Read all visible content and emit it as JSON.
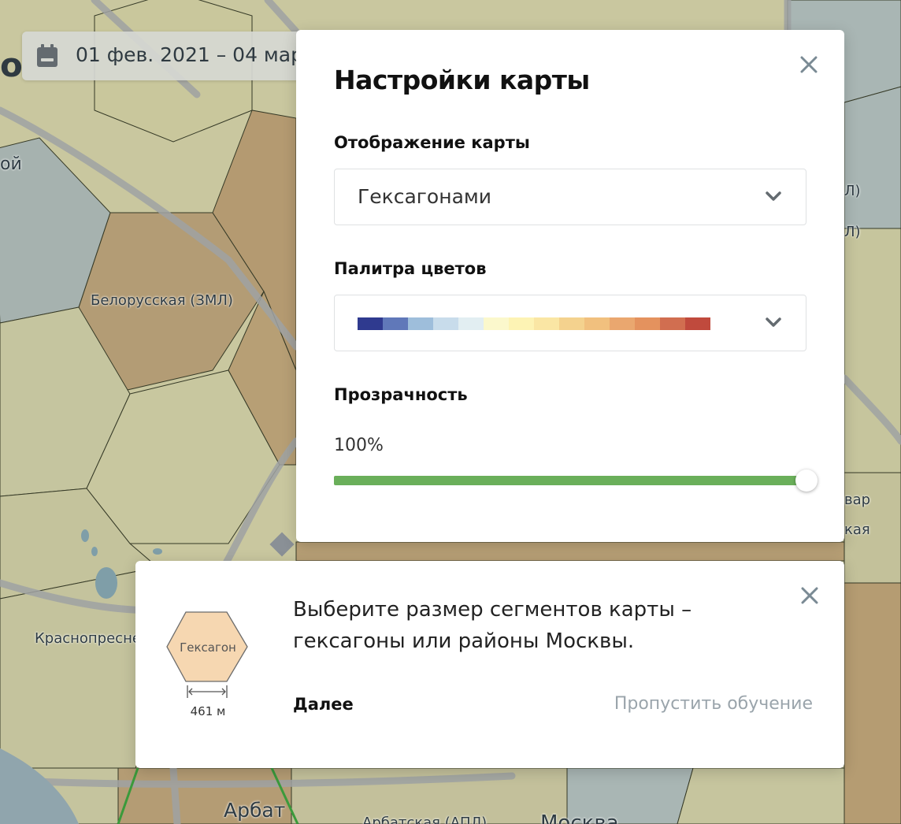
{
  "header": {
    "date_range": "01 фев. 2021 – 04 мар",
    "calendar_icon": "calendar-icon",
    "partial_title": "ок"
  },
  "map": {
    "labels": {
      "belorusskaya": "Белорусская (ЗМЛ)",
      "krasnopresnenskaya": "Краснопресне",
      "arbat": "Арбат",
      "arbatskaya": "Арбатская (АПЛ)",
      "moskva": "Москва",
      "left_partial": "ой",
      "right_1": "Л)",
      "right_2": "Л)",
      "right_3": "вар",
      "right_4": "кая"
    }
  },
  "settings": {
    "title": "Настройки карты",
    "display_label": "Отображение карты",
    "display_value": "Гексагонами",
    "palette_label": "Палитра цветов",
    "palette_colors": [
      "#2f3a8f",
      "#6078b9",
      "#9ebedb",
      "#c8dceb",
      "#e2eef2",
      "#fbf8cc",
      "#fdf3b4",
      "#fae6a4",
      "#f4d28e",
      "#f1c07e",
      "#eaa76f",
      "#e4925e",
      "#d16e50",
      "#c04a3d"
    ],
    "opacity_label": "Прозрачность",
    "opacity_value": "100%",
    "opacity_fraction": 1.0,
    "close_icon": "close-icon",
    "chevron_icon": "chevron-down-icon"
  },
  "tutorial": {
    "text": "Выберите размер сегментов карты – гексагоны или районы Москвы.",
    "next_label": "Далее",
    "skip_label": "Пропустить обучение",
    "hex_label": "Гексагон",
    "hex_size": "461 м",
    "close_icon": "close-icon"
  },
  "colors": {
    "slider_fill": "#6aaf5a",
    "hex_fill": "#f6d7b1"
  }
}
